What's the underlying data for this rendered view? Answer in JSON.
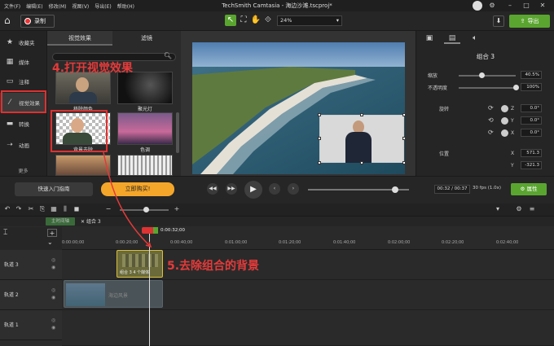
{
  "menubar": {
    "items": [
      "文件(F)",
      "编辑(E)",
      "修改(M)",
      "视图(V)",
      "导出(E)",
      "帮助(H)"
    ],
    "title": "TechSmith Camtasia - 海边沙滩.tscproj*"
  },
  "toolbar": {
    "record_label": "录制",
    "zoom_value": "24%",
    "export_label": "导出"
  },
  "sidebar": {
    "items": [
      {
        "icon": "star-icon",
        "label": "收藏夹"
      },
      {
        "icon": "media-icon",
        "label": "媒体"
      },
      {
        "icon": "annotation-icon",
        "label": "注释"
      },
      {
        "icon": "wand-icon",
        "label": "视觉效果"
      },
      {
        "icon": "transition-icon",
        "label": "转换"
      },
      {
        "icon": "animation-icon",
        "label": "动画"
      }
    ],
    "more_label": "更多"
  },
  "library": {
    "tabs": [
      "视觉效果",
      "滤镜"
    ],
    "items": [
      {
        "label": "移除颜色"
      },
      {
        "label": "聚光灯"
      },
      {
        "label": "背景去除"
      },
      {
        "label": "色调"
      }
    ]
  },
  "properties": {
    "title": "组合 3",
    "scale_label": "缩放",
    "scale_value": "40.5%",
    "scale_level": 0.405,
    "opacity_label": "不透明度",
    "opacity_value": "100%",
    "opacity_level": 1.0,
    "rotation_label": "旋转",
    "rotation": [
      {
        "axis": "Z",
        "value": "0.0°"
      },
      {
        "axis": "Y",
        "value": "0.0°"
      },
      {
        "axis": "X",
        "value": "0.0°"
      }
    ],
    "position_label": "位置",
    "position": [
      {
        "axis": "X",
        "value": "571.3"
      },
      {
        "axis": "Y",
        "value": "-321.3"
      }
    ]
  },
  "playback": {
    "guide_label": "快速入门指南",
    "buy_label": "立即购买!",
    "time": "00:32 / 00:37",
    "fps": "30 fps (1.0x)",
    "props_label": "属性",
    "progress": 0.865
  },
  "timeline": {
    "main_tab": "主时间轴",
    "group_tab": "组合 3",
    "playhead_time": "0:00:32;00",
    "ruler": [
      "0:00:00;00",
      "0:00:20;00",
      "0:00:40;00",
      "0:01:00;00",
      "0:01:20;00",
      "0:01:40;00",
      "0:02:00;00",
      "0:02:20;00",
      "0:02:40;00"
    ],
    "tracks": [
      "轨道 3",
      "轨道 2",
      "轨道 1"
    ],
    "clip_group_label": "组合 3  4 个媒体",
    "clip_sea_label": "海边风景"
  },
  "annotations": {
    "step4": "4.打开视觉效果",
    "step5": "5.去除组合的背景"
  }
}
